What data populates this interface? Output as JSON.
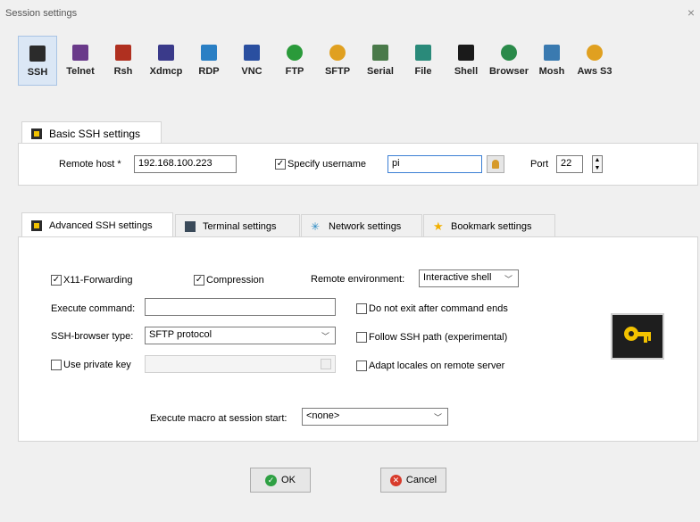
{
  "window": {
    "title": "Session settings",
    "close": "×"
  },
  "protocols": [
    {
      "label": "SSH",
      "icon": "ssh-icon",
      "color": "#2b2b2b"
    },
    {
      "label": "Telnet",
      "icon": "telnet-icon",
      "color": "#6a3a8a"
    },
    {
      "label": "Rsh",
      "icon": "rsh-icon",
      "color": "#b03020"
    },
    {
      "label": "Xdmcp",
      "icon": "xdmcp-icon",
      "color": "#3a3a8a"
    },
    {
      "label": "RDP",
      "icon": "rdp-icon",
      "color": "#2a7fc4"
    },
    {
      "label": "VNC",
      "icon": "vnc-icon",
      "color": "#2a4fa0"
    },
    {
      "label": "FTP",
      "icon": "ftp-icon",
      "color": "#2a9a3a"
    },
    {
      "label": "SFTP",
      "icon": "sftp-icon",
      "color": "#e0a020"
    },
    {
      "label": "Serial",
      "icon": "serial-icon",
      "color": "#4a7a4a"
    },
    {
      "label": "File",
      "icon": "file-icon",
      "color": "#2a8a7a"
    },
    {
      "label": "Shell",
      "icon": "shell-icon",
      "color": "#1a1a1a"
    },
    {
      "label": "Browser",
      "icon": "browser-icon",
      "color": "#2a8a4a"
    },
    {
      "label": "Mosh",
      "icon": "mosh-icon",
      "color": "#3a7ab0"
    },
    {
      "label": "Aws S3",
      "icon": "aws-s3-icon",
      "color": "#e0a020"
    }
  ],
  "basic": {
    "tab_label": "Basic SSH settings",
    "remote_host_label": "Remote host *",
    "remote_host_value": "192.168.100.223",
    "specify_username_label": "Specify username",
    "specify_username_checked": true,
    "username_value": "pi",
    "port_label": "Port",
    "port_value": "22"
  },
  "advanced_tabs": [
    {
      "label": "Advanced SSH settings",
      "active": true
    },
    {
      "label": "Terminal settings",
      "active": false
    },
    {
      "label": "Network settings",
      "active": false
    },
    {
      "label": "Bookmark settings",
      "active": false
    }
  ],
  "advanced": {
    "x11_label": "X11-Forwarding",
    "x11_checked": true,
    "compression_label": "Compression",
    "compression_checked": true,
    "remote_env_label": "Remote environment:",
    "remote_env_value": "Interactive shell",
    "exec_cmd_label": "Execute command:",
    "exec_cmd_value": "",
    "no_exit_label": "Do not exit after command ends",
    "browser_type_label": "SSH-browser type:",
    "browser_type_value": "SFTP protocol",
    "follow_path_label": "Follow SSH path (experimental)",
    "private_key_label": "Use private key",
    "adapt_locales_label": "Adapt locales on remote server",
    "macro_label": "Execute macro at session start:",
    "macro_value": "<none>"
  },
  "buttons": {
    "ok": "OK",
    "cancel": "Cancel"
  },
  "colors": {
    "ok_green": "#2ea043",
    "cancel_red": "#d83b2b",
    "key_yellow": "#f2c200"
  }
}
